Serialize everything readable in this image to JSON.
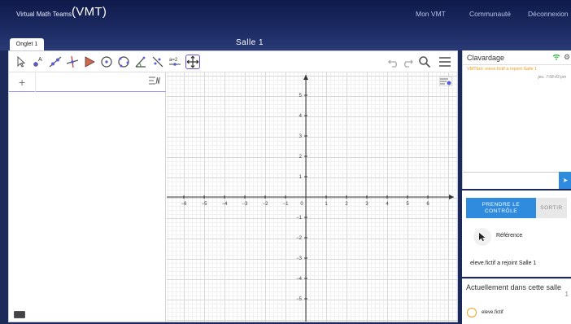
{
  "header": {
    "brand_small": "Virtual Math Teams",
    "brand_big": "(VMT)",
    "nav": [
      "Mon VMT",
      "Communauté",
      "Déconnexion"
    ]
  },
  "tabs": [
    {
      "label": "Onglet 1"
    }
  ],
  "room": {
    "title": "Salle 1"
  },
  "ggb": {
    "toolbar_tools": [
      "move-tool",
      "point-tool",
      "line-tool",
      "perpendicular-tool",
      "polygon-tool",
      "circle-center-tool",
      "circle-three-points-tool",
      "angle-tool",
      "reflect-tool",
      "slider-tool",
      "move-graphics-tool"
    ],
    "axes": {
      "x_labels": [
        "−6",
        "−5",
        "−4",
        "−3",
        "−2",
        "−1",
        "0",
        "1",
        "2",
        "3",
        "4",
        "5",
        "6"
      ],
      "y_labels": [
        "6",
        "5",
        "4",
        "3",
        "2",
        "1",
        "−1",
        "−2",
        "−3",
        "−4",
        "−5"
      ]
    },
    "algebra_plus": "+"
  },
  "chat": {
    "title": "Clavardage",
    "message": "VMTbot: eleve.fictif a rejoint Salle 1",
    "time": "jeu. 7:58:43 pm",
    "send_icon": "send-icon"
  },
  "control": {
    "take_label_1": "PRENDRE LE",
    "take_label_2": "CONTRÔLE",
    "exit_label": "SORTIR",
    "reference_label": "Référence",
    "join_message": "eleve.fictif a rejoint Salle 1"
  },
  "members": {
    "title": "Actuellement dans cette salle",
    "count": "1",
    "list": [
      {
        "name": "eleve.fictif"
      }
    ]
  },
  "colors": {
    "accent": "#2e8bde",
    "header": "#0f1a4a",
    "tool_accent": "#6557d2",
    "chat_msg": "#f09d20"
  }
}
